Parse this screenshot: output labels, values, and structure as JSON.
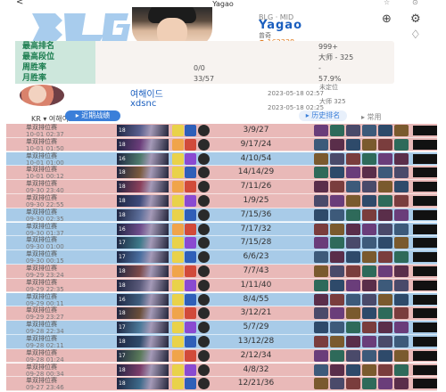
{
  "topbar": {
    "back": "<",
    "title": "Yagao",
    "right1": "☆",
    "right2": "⊙"
  },
  "player": {
    "team_role": "BLG · MID",
    "name": "Yagao",
    "real_name": "曾奇",
    "points": "162338"
  },
  "stats": [
    {
      "label": "最高排名",
      "v1": "",
      "v2": "999+"
    },
    {
      "label": "最高段位",
      "v1": "",
      "v2": "大师 - 325"
    },
    {
      "label": "周胜率",
      "v1": "0/0",
      "v2": "-"
    },
    {
      "label": "月胜率",
      "v1": "33/57",
      "v2": "57.9%"
    }
  ],
  "account": {
    "name1": "여해이드",
    "name2": "xdsnc",
    "date1": "2023-05-18 02:57",
    "date2": "2023-05-18 02:25",
    "rank1": "未定位",
    "rank2": "大师 325"
  },
  "tabs": {
    "region": "KR ▾ 여해이드",
    "recent": "▸ 近期战绩",
    "history": "▸ 历史排名",
    "extra": "▸ 常用"
  },
  "matches": [
    {
      "result": "lose",
      "mode": "单双排位赛",
      "date": "10-01 02:37",
      "level": "18",
      "kda": "3/9/27",
      "champ_color": "#5a5f8e"
    },
    {
      "result": "lose",
      "mode": "单双排位赛",
      "date": "10-01 01:50",
      "level": "18",
      "kda": "9/17/24",
      "champ_color": "#6b3d7a"
    },
    {
      "result": "win",
      "mode": "单双排位赛",
      "date": "10-01 01:00",
      "level": "16",
      "kda": "4/10/54",
      "champ_color": "#4e7a6c"
    },
    {
      "result": "lose",
      "mode": "单双排位赛",
      "date": "10-01 00:12",
      "level": "18",
      "kda": "14/14/29",
      "champ_color": "#7a5a3d"
    },
    {
      "result": "lose",
      "mode": "单双排位赛",
      "date": "09-30 23:40",
      "level": "18",
      "kda": "7/11/26",
      "champ_color": "#8a3f5a"
    },
    {
      "result": "lose",
      "mode": "单双排位赛",
      "date": "09-30 22:55",
      "level": "18",
      "kda": "1/9/25",
      "champ_color": "#3d4a7a"
    },
    {
      "result": "win",
      "mode": "单双排位赛",
      "date": "09-30 02:35",
      "level": "18",
      "kda": "7/15/36",
      "champ_color": "#5c6e9a"
    },
    {
      "result": "win",
      "mode": "单双排位赛",
      "date": "09-30 01:37",
      "level": "16",
      "kda": "7/17/32",
      "champ_color": "#6e4d8c"
    },
    {
      "result": "win",
      "mode": "单双排位赛",
      "date": "09-30 01:00",
      "level": "17",
      "kda": "7/15/28",
      "champ_color": "#3d7a8a"
    },
    {
      "result": "win",
      "mode": "单双排位赛",
      "date": "09-30 00:15",
      "level": "17",
      "kda": "6/6/23",
      "champ_color": "#4a6fa0"
    },
    {
      "result": "lose",
      "mode": "单双排位赛",
      "date": "09-29 23:24",
      "level": "18",
      "kda": "7/7/43",
      "champ_color": "#7d4a4a"
    },
    {
      "result": "lose",
      "mode": "单双排位赛",
      "date": "09-29 22:35",
      "level": "18",
      "kda": "1/11/40",
      "champ_color": "#5a5a7a"
    },
    {
      "result": "win",
      "mode": "单双排位赛",
      "date": "09-29 00:11",
      "level": "16",
      "kda": "8/4/55",
      "champ_color": "#3e5e7e"
    },
    {
      "result": "lose",
      "mode": "单双排位赛",
      "date": "09-29 23:27",
      "level": "18",
      "kda": "3/12/21",
      "champ_color": "#6a4e3a"
    },
    {
      "result": "win",
      "mode": "单双排位赛",
      "date": "09-28 22:34",
      "level": "17",
      "kda": "5/7/29",
      "champ_color": "#4c7a9a"
    },
    {
      "result": "win",
      "mode": "单双排位赛",
      "date": "09-28 02:11",
      "level": "18",
      "kda": "13/12/28",
      "champ_color": "#2e4a6a"
    },
    {
      "result": "lose",
      "mode": "单双排位赛",
      "date": "09-28 01:24",
      "level": "17",
      "kda": "2/12/34",
      "champ_color": "#5a7a5a"
    },
    {
      "result": "lose",
      "mode": "单双排位赛",
      "date": "09-28 00:34",
      "level": "18",
      "kda": "4/8/32",
      "champ_color": "#7a3d6a"
    },
    {
      "result": "lose",
      "mode": "单双排位赛",
      "date": "09-27 23:46",
      "level": "18",
      "kda": "12/21/36",
      "champ_color": "#3d6a8a"
    }
  ],
  "colors": {
    "accent": "#1b5fbf",
    "win_row": "#a8cbe8",
    "lose_row": "#e9b9b8",
    "stat_label_bg": "#cde7dc",
    "stat_label_text": "#1a7c4e"
  },
  "icons": {
    "back": "back-icon",
    "star": "star-icon",
    "more": "more-icon",
    "coin": "coin-icon",
    "share": "share-icon",
    "bell": "bell-icon"
  }
}
